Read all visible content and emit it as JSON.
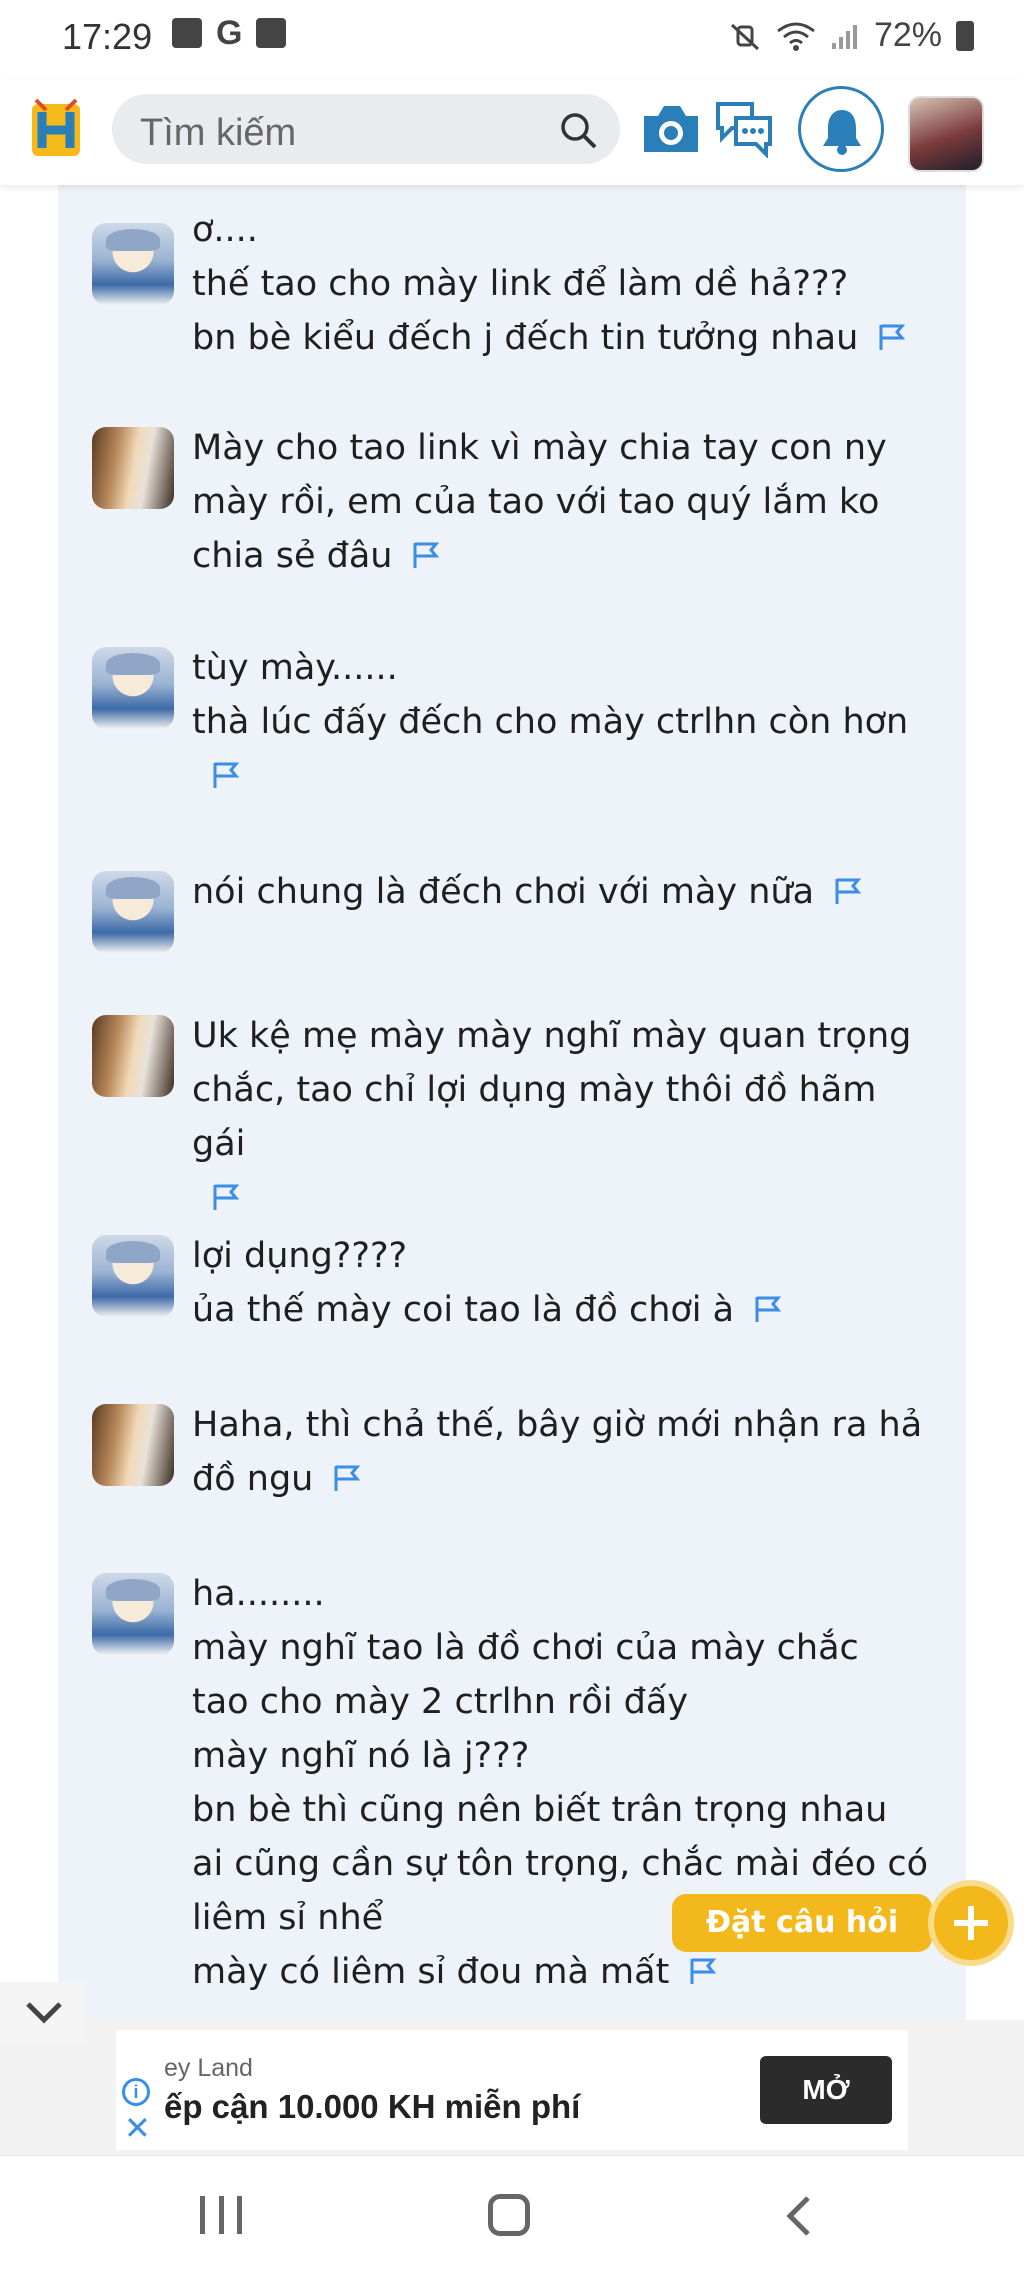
{
  "status_bar": {
    "time": "17:29",
    "battery": "72%",
    "left_icons": [
      "gallery-icon",
      "google-icon",
      "check-icon"
    ],
    "right_icons": [
      "mute-icon",
      "wifi-icon",
      "signal-icon",
      "battery-icon"
    ]
  },
  "header": {
    "search_placeholder": "Tìm kiếm",
    "icons": [
      "camera-icon",
      "chat-icon",
      "bell-icon",
      "avatar"
    ],
    "accent_color": "#2b7fb8"
  },
  "messages": [
    {
      "avatar": "a",
      "lines": [
        "ơ....",
        "thế tao cho mày link để làm dề hả???",
        "bn bè kiểu đếch j đếch tin tưởng nhau"
      ]
    },
    {
      "avatar": "b",
      "lines": [
        "Mày cho tao link vì mày chia tay con ny",
        "mày rồi, em của tao với tao quý lắm ko",
        "chia sẻ đâu"
      ]
    },
    {
      "avatar": "a",
      "lines": [
        "tùy mày......",
        "thà lúc đấy đếch cho mày ctrlhn còn hơn"
      ]
    },
    {
      "avatar": "a",
      "lines": [
        "nói chung là đếch chơi với  mày nữa"
      ]
    },
    {
      "avatar": "b",
      "lines": [
        "Uk kệ mẹ mày mày nghĩ mày quan trọng",
        "chắc, tao chỉ lợi dụng mày thôi đồ hãm gái"
      ]
    },
    {
      "avatar": "a",
      "lines": [
        "lợi dụng????",
        "ủa thế mày coi tao là đồ chơi à"
      ]
    },
    {
      "avatar": "b",
      "lines": [
        "Haha, thì chả thế, bây giờ mới nhận ra hả",
        "đồ ngu"
      ]
    },
    {
      "avatar": "a",
      "lines": [
        "ha........",
        "mày nghĩ tao là đồ chơi của mày chắc",
        "tao cho mày 2 ctrlhn rồi đấy",
        "mày nghĩ nó là j???",
        "bn bè thì cũng nên biết trân trọng nhau",
        "ai cũng cần sự tôn trọng, chắc mài đéo có",
        "liêm sỉ nhể",
        "mày có liêm sỉ đou mà mất"
      ]
    }
  ],
  "ask_button": {
    "label": "Đặt câu hỏi",
    "color": "#f2b81c"
  },
  "ad": {
    "brand": "ey Land",
    "text": "ếp cận 10.000 KH miễn phí",
    "button": "MỞ"
  },
  "nav": {
    "icons": [
      "recent-apps-icon",
      "home-icon",
      "back-icon"
    ]
  }
}
